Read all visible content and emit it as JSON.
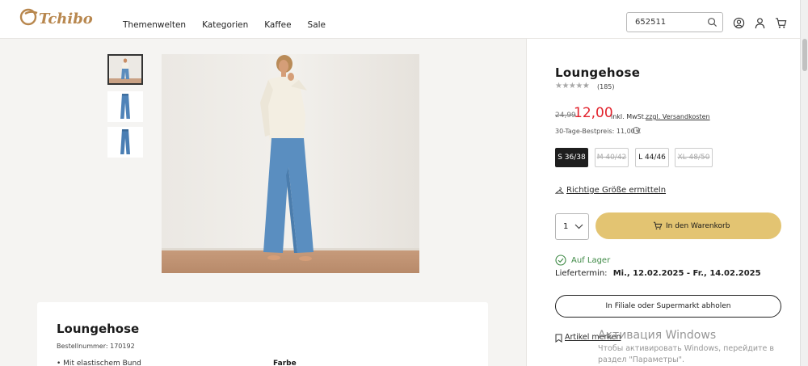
{
  "header": {
    "logo_text": "Tchibo",
    "nav": [
      "Themenwelten",
      "Kategorien",
      "Kaffee",
      "Sale"
    ],
    "search_value": "652511",
    "icons": [
      "search-icon",
      "account-icon",
      "user-icon",
      "cart-icon"
    ]
  },
  "gallery": {
    "thumbnails": [
      "thumbnail-model",
      "thumbnail-pants-front",
      "thumbnail-pants-back"
    ],
    "selected_index": 0
  },
  "product": {
    "title": "Loungehose",
    "rating_stars": 4,
    "rating_max": 5,
    "review_count": "(185)",
    "old_price": "24,99",
    "new_price": "12,00",
    "vat": "inkl. MwSt.",
    "shipping": "zzgl. Versandkosten",
    "best_price_30": "30-Tage-Bestpreis: 11,00 €",
    "sizes": [
      {
        "label": "S 36/38",
        "state": "selected"
      },
      {
        "label": "M 40/42",
        "state": "unavailable"
      },
      {
        "label": "L 44/46",
        "state": "available"
      },
      {
        "label": "XL 48/50",
        "state": "unavailable"
      }
    ],
    "size_guide": "Richtige Größe ermitteln",
    "quantity": "1",
    "add_to_cart": "In den Warenkorb",
    "stock_status": "Auf Lager",
    "delivery_label": "Liefertermin:",
    "delivery_dates": "Mi., 12.02.2025 - Fr., 14.02.2025",
    "pickup": "In Filiale oder Supermarkt abholen",
    "remember": "Artikel merken"
  },
  "details": {
    "title": "Loungehose",
    "order_number": "Bestellnummer: 170192",
    "bullet": "Mit elastischem Bund",
    "color_label": "Farbe"
  },
  "watermark": {
    "title": "Активация Windows",
    "subtitle": "Чтобы активировать Windows, перейдите в раздел \"Параметры\"."
  },
  "colors": {
    "accent_gold": "#e3c472",
    "sale_red": "#e2232d",
    "stock_green": "#3f8a46",
    "brand_brown": "#b8874e"
  }
}
